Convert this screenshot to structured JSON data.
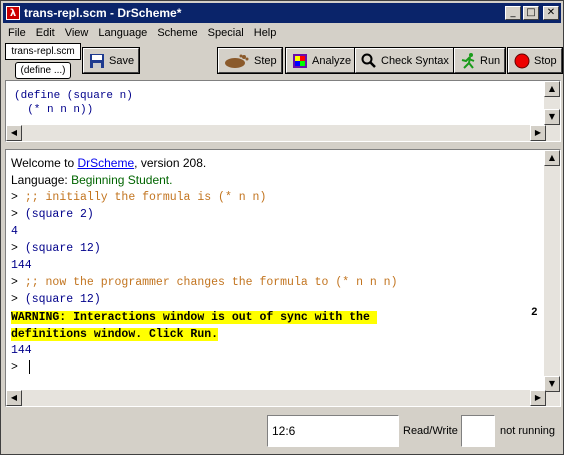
{
  "window": {
    "title": "trans-repl.scm - DrScheme*",
    "app_icon": "λ"
  },
  "menu": {
    "items": [
      "File",
      "Edit",
      "View",
      "Language",
      "Scheme",
      "Special",
      "Help"
    ]
  },
  "toolbar": {
    "file_name": "trans-repl.scm",
    "define_label": "(define ...)",
    "save_label": "Save",
    "step_label": "Step",
    "analyze_label": "Analyze",
    "check_syntax_label": "Check Syntax",
    "run_label": "Run",
    "stop_label": "Stop"
  },
  "definitions": {
    "line1": "(define (square n)",
    "line2": "  (* n n n))"
  },
  "interactions": {
    "welcome_prefix": "Welcome to ",
    "welcome_link": "DrScheme",
    "welcome_suffix": ", version 208.",
    "language_prefix": "Language: ",
    "language_value": "Beginning Student.",
    "prompt": "> ",
    "comment1": ";; initially the formula is (* n n)",
    "expr1": "(square 2)",
    "result1": "4",
    "expr2": "(square 12)",
    "result2": "144",
    "comment2": ";; now the programmer changes the formula to (* n n n)",
    "expr3": "(square 12)",
    "warning_line1": "WARNING: Interactions window is out of sync with the ",
    "warning_line2": "definitions window. Click Run.",
    "result3": "144",
    "margin_mark": "2"
  },
  "status": {
    "position": "12:6",
    "mode": "Read/Write",
    "running": "not running"
  },
  "colors": {
    "title_bar": "#0a246a",
    "warning_bg": "#ffff00",
    "comment": "#c2741f",
    "code": "#00008b",
    "language": "#006400"
  }
}
